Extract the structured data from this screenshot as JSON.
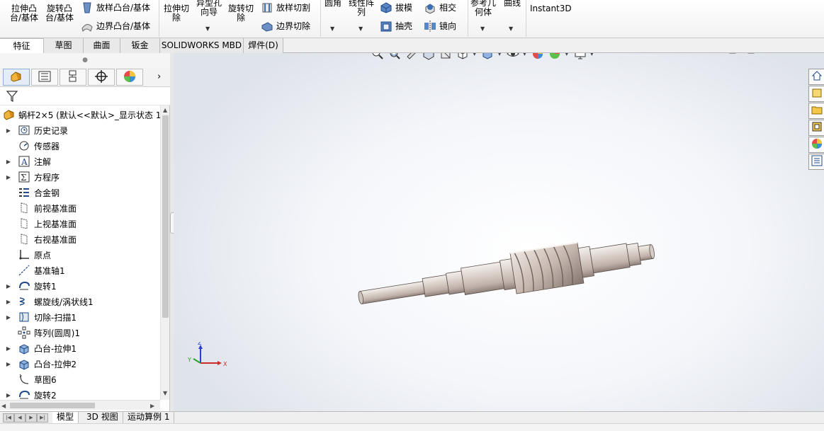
{
  "command_manager": {
    "extrude_boss": "拉伸凸台/基体",
    "revolve_boss": "旋转凸台/基体",
    "swept_boss": "放样凸台/基体",
    "boundary_boss": "边界凸台/基体",
    "extrude_cut": "拉伸切除",
    "hole_wizard": "异型孔向导",
    "revolve_cut": "旋转切除",
    "lofted_cut": "放样切割",
    "boundary_cut": "边界切除",
    "fillet": "圆角",
    "linear_pattern": "线性阵列",
    "draft": "拔模",
    "shell": "抽壳",
    "intersect": "相交",
    "mirror": "镜向",
    "ref_geometry": "参考几何体",
    "curves": "曲线",
    "instant3d": "Instant3D"
  },
  "tabs": [
    "特征",
    "草图",
    "曲面",
    "钣金",
    "SOLIDWORKS MBD",
    "焊件(D)"
  ],
  "active_tab": "特征",
  "feature_tree": {
    "root": "蜗杆2×5  (默认<<默认>_显示状态 1",
    "items": [
      {
        "label": "历史记录",
        "icon": "history-icon",
        "expandable": true
      },
      {
        "label": "传感器",
        "icon": "sensor-icon",
        "expandable": false
      },
      {
        "label": "注解",
        "icon": "annotation-icon",
        "expandable": true
      },
      {
        "label": "方程序",
        "icon": "equation-icon",
        "expandable": true
      },
      {
        "label": "合金钢",
        "icon": "material-icon",
        "expandable": false
      },
      {
        "label": "前视基准面",
        "icon": "plane-icon",
        "expandable": false
      },
      {
        "label": "上视基准面",
        "icon": "plane-icon",
        "expandable": false
      },
      {
        "label": "右视基准面",
        "icon": "plane-icon",
        "expandable": false
      },
      {
        "label": "原点",
        "icon": "origin-icon",
        "expandable": false
      },
      {
        "label": "基准轴1",
        "icon": "axis-icon",
        "expandable": false
      },
      {
        "label": "旋转1",
        "icon": "revolve-icon",
        "expandable": true
      },
      {
        "label": "螺旋线/涡状线1",
        "icon": "helix-icon",
        "expandable": true
      },
      {
        "label": "切除-扫描1",
        "icon": "cut-sweep-icon",
        "expandable": true
      },
      {
        "label": "阵列(圆周)1",
        "icon": "circular-pattern-icon",
        "expandable": false
      },
      {
        "label": "凸台-拉伸1",
        "icon": "boss-extrude-icon",
        "expandable": true
      },
      {
        "label": "凸台-拉伸2",
        "icon": "boss-extrude-icon",
        "expandable": true
      },
      {
        "label": "草图6",
        "icon": "sketch-icon",
        "expandable": false
      },
      {
        "label": "旋转2",
        "icon": "revolve-icon",
        "expandable": true
      }
    ]
  },
  "bottom_tabs": [
    "模型",
    "3D 视图",
    "运动算例 1"
  ],
  "active_bottom_tab": "模型",
  "triad": {
    "x": "X",
    "y": "Y",
    "z": "Z"
  },
  "colors": {
    "accent_blue": "#1f5fa8",
    "tab_active": "#ffffff",
    "model_shade": "#d8cfc9"
  }
}
